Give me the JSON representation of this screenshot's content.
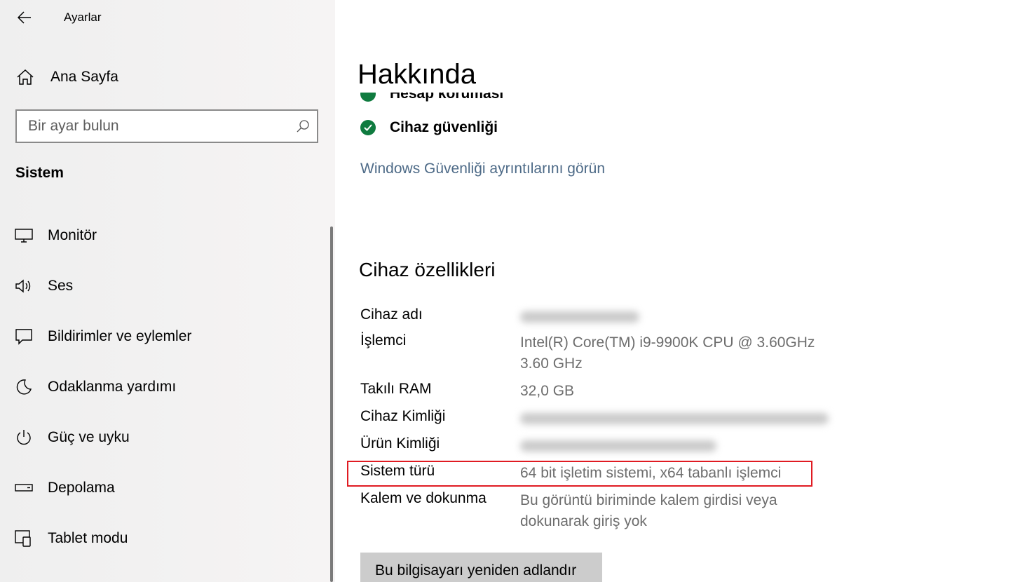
{
  "app": {
    "title": "Ayarlar"
  },
  "sidebar": {
    "home_label": "Ana Sayfa",
    "search_placeholder": "Bir ayar bulun",
    "section_title": "Sistem",
    "items": [
      {
        "label": "Monitör",
        "icon": "monitor-icon"
      },
      {
        "label": "Ses",
        "icon": "speaker-icon"
      },
      {
        "label": "Bildirimler ve eylemler",
        "icon": "notification-icon"
      },
      {
        "label": "Odaklanma yardımı",
        "icon": "moon-icon"
      },
      {
        "label": "Güç ve uyku",
        "icon": "power-icon"
      },
      {
        "label": "Depolama",
        "icon": "storage-icon"
      },
      {
        "label": "Tablet modu",
        "icon": "tablet-mode-icon"
      }
    ]
  },
  "main": {
    "page_title": "Hakkında",
    "security": {
      "cut_item": "Hesap koruması",
      "item": "Cihaz güvenliği",
      "link": "Windows Güvenliği ayrıntılarını görün"
    },
    "specs": {
      "title": "Cihaz özellikleri",
      "rows": [
        {
          "key": "Cihaz adı",
          "value": ""
        },
        {
          "key": "İşlemci",
          "value": "Intel(R) Core(TM) i9-9900K CPU @ 3.60GHz",
          "value2": "3.60 GHz"
        },
        {
          "key": "Takılı RAM",
          "value": "32,0 GB"
        },
        {
          "key": "Cihaz Kimliği",
          "value": ""
        },
        {
          "key": "Ürün Kimliği",
          "value": ""
        },
        {
          "key": "Sistem türü",
          "value": "64 bit işletim sistemi, x64 tabanlı işlemci"
        },
        {
          "key": "Kalem ve dokunma",
          "value": "Bu görüntü biriminde kalem girdisi veya",
          "value2": "dokunarak giriş yok"
        }
      ]
    },
    "rename_button": "Bu bilgisayarı yeniden adlandır"
  },
  "colors": {
    "check_green": "#0f7b3f",
    "link": "#4d6a87",
    "highlight": "#e01b22"
  }
}
